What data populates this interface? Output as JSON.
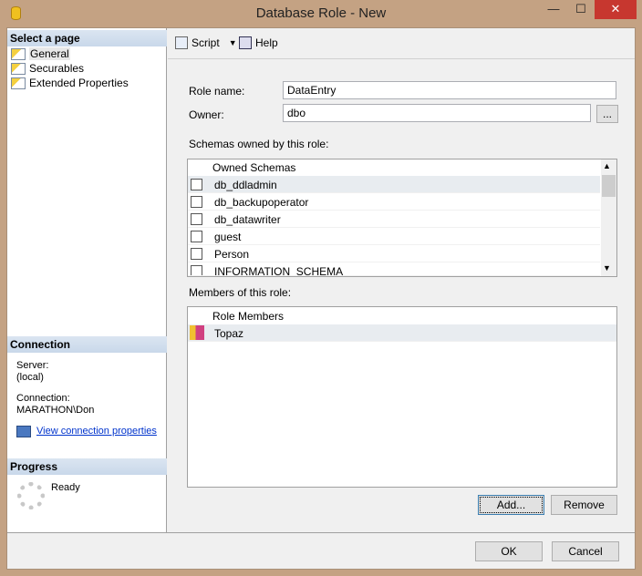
{
  "window": {
    "title": "Database Role - New",
    "minimize": "—",
    "maximize": "☐",
    "close": "✕"
  },
  "sidebar": {
    "select_header": "Select a page",
    "pages": [
      {
        "label": "General"
      },
      {
        "label": "Securables"
      },
      {
        "label": "Extended Properties"
      }
    ],
    "connection_header": "Connection",
    "server_label": "Server:",
    "server_value": "(local)",
    "connection_label": "Connection:",
    "connection_value": "MARATHON\\Don",
    "view_link": "View connection properties",
    "progress_header": "Progress",
    "progress_status": "Ready"
  },
  "toolbar": {
    "script": "Script",
    "help": "Help"
  },
  "form": {
    "role_name_label": "Role name:",
    "role_name": "DataEntry",
    "owner_label": "Owner:",
    "owner": "dbo",
    "browse": "...",
    "schemas_label": "Schemas owned by this role:",
    "members_label": "Members of this role:"
  },
  "schemas": {
    "header": "Owned Schemas",
    "rows": [
      {
        "name": "db_ddladmin",
        "checked": false
      },
      {
        "name": "db_backupoperator",
        "checked": false
      },
      {
        "name": "db_datawriter",
        "checked": false
      },
      {
        "name": "guest",
        "checked": false
      },
      {
        "name": "Person",
        "checked": false
      },
      {
        "name": "INFORMATION_SCHEMA",
        "checked": false
      }
    ]
  },
  "members": {
    "header": "Role Members",
    "rows": [
      {
        "name": "Topaz"
      }
    ]
  },
  "buttons": {
    "add": "Add...",
    "remove": "Remove",
    "ok": "OK",
    "cancel": "Cancel"
  }
}
